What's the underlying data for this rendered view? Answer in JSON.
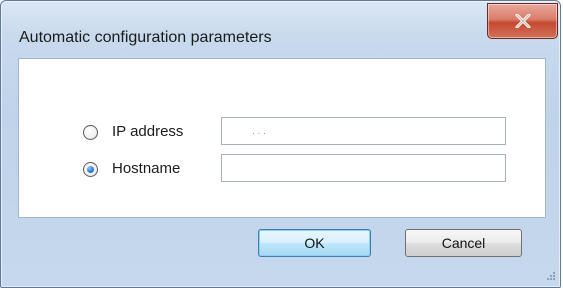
{
  "window": {
    "title": "Automatic configuration parameters",
    "close_glyph": "X"
  },
  "options": [
    {
      "label": "IP address",
      "selected": false,
      "value": ". . .",
      "placeholder": ""
    },
    {
      "label": "Hostname",
      "selected": true,
      "value": "",
      "placeholder": ""
    }
  ],
  "buttons": {
    "ok": "OK",
    "cancel": "Cancel"
  },
  "colors": {
    "accent": "#2a7fd0",
    "close_button": "#c44a31",
    "frame": "#c6d8ec"
  }
}
